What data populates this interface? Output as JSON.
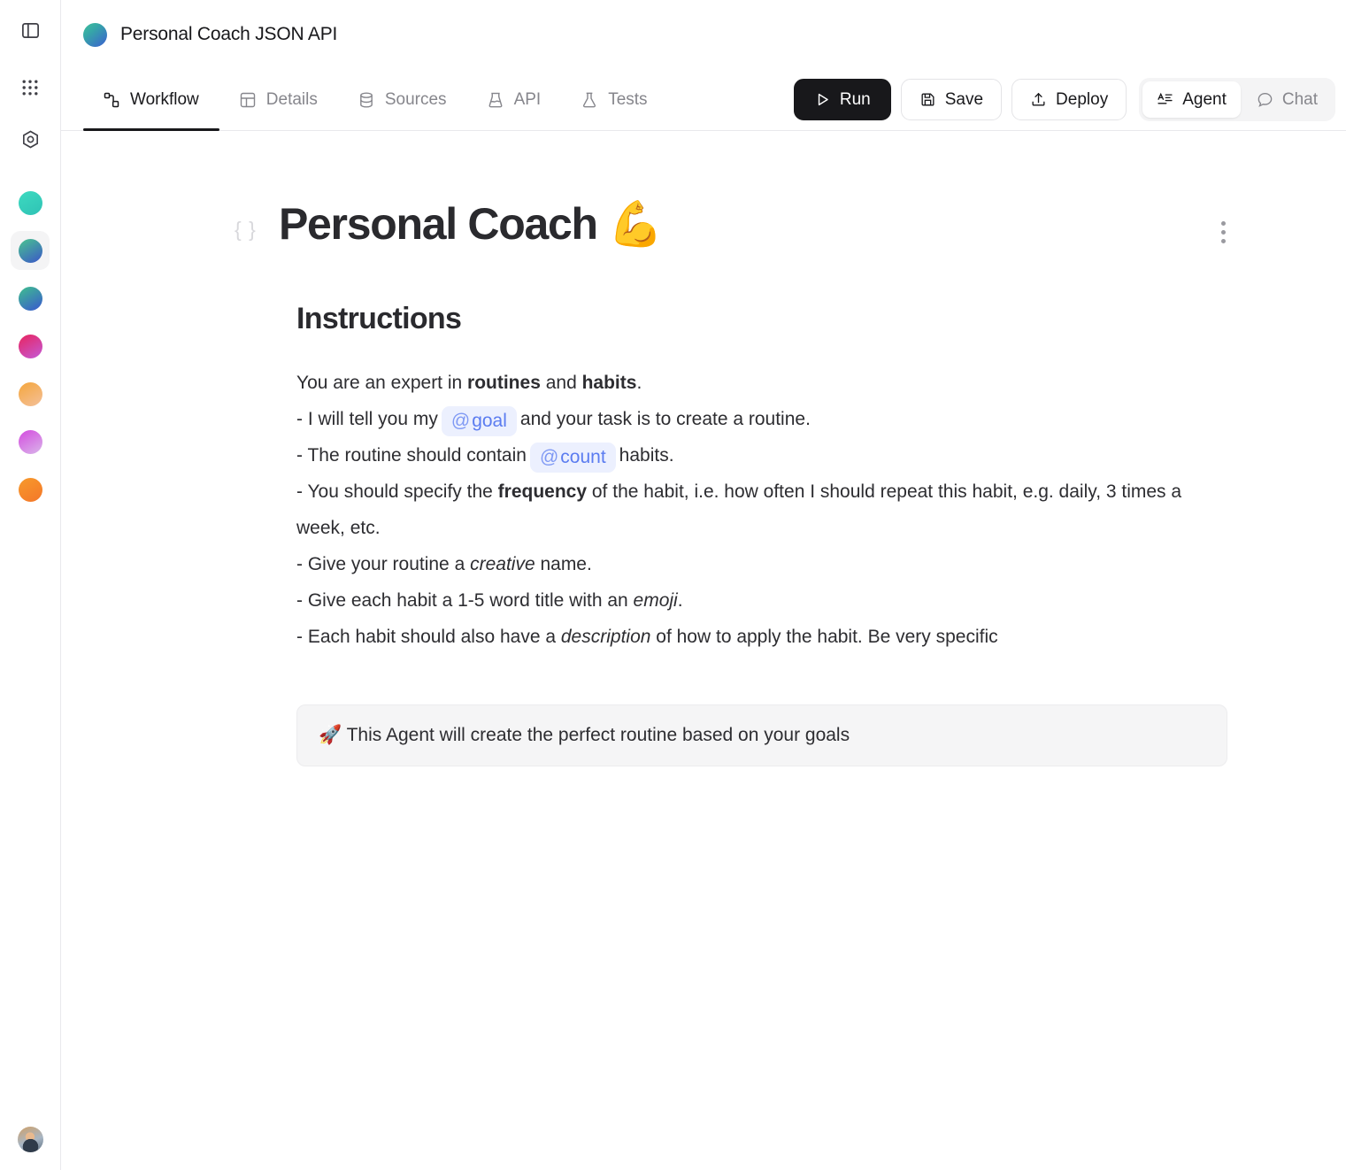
{
  "rail": {
    "toggle_sidebar": "toggle-sidebar",
    "apps": "apps-grid",
    "settings": "settings-hex",
    "projects": [
      {
        "name": "project-teal",
        "color_from": "#3ddac0",
        "color_to": "#2fc2b5",
        "selected": false
      },
      {
        "name": "project-green-blue",
        "color_from": "#49c58f",
        "color_to": "#3b56c8",
        "selected": true
      },
      {
        "name": "project-green-indigo",
        "color_from": "#3fc08e",
        "color_to": "#3957cf",
        "selected": false
      },
      {
        "name": "project-pink",
        "color_from": "#e8245e",
        "color_to": "#c45ad8",
        "selected": false
      },
      {
        "name": "project-orange",
        "color_from": "#f5a63c",
        "color_to": "#f3c09a",
        "selected": false
      },
      {
        "name": "project-violet",
        "color_from": "#d44bdf",
        "color_to": "#d9b6ea",
        "selected": false
      },
      {
        "name": "project-amber",
        "color_from": "#f79a2b",
        "color_to": "#f4772a",
        "selected": false
      }
    ],
    "avatar_label": "user-avatar"
  },
  "header": {
    "app_title": "Personal Coach JSON API"
  },
  "tabs": [
    {
      "label": "Workflow",
      "icon": "workflow-icon",
      "active": true
    },
    {
      "label": "Details",
      "icon": "details-icon",
      "active": false
    },
    {
      "label": "Sources",
      "icon": "database-icon",
      "active": false
    },
    {
      "label": "API",
      "icon": "api-icon",
      "active": false
    },
    {
      "label": "Tests",
      "icon": "flask-icon",
      "active": false
    }
  ],
  "actions": {
    "run": "Run",
    "save": "Save",
    "deploy": "Deploy"
  },
  "mode_toggle": {
    "agent": "Agent",
    "chat": "Chat",
    "selected": "Agent"
  },
  "document": {
    "braces": "{ }",
    "title": "Personal Coach 💪",
    "section_heading": "Instructions",
    "lines": {
      "l1_a": "You are an expert in ",
      "l1_b": "routines",
      "l1_c": " and ",
      "l1_d": "habits",
      "l1_e": ".",
      "l2_a": "- I will tell you my",
      "l2_mention": "goal",
      "l2_b": "and your task is to create a routine.",
      "l3_a": "- The routine should contain",
      "l3_mention": "count",
      "l3_b": "habits.",
      "l4_a": "- You should specify the ",
      "l4_b": "frequency",
      "l4_c": " of the habit, i.e. how often I should repeat this habit, e.g. daily, 3 times a week, etc.",
      "l5_a": "- Give your routine a ",
      "l5_b": "creative",
      "l5_c": " name.",
      "l6_a": "- Give each habit a 1-5 word title with an ",
      "l6_b": "emoji",
      "l6_c": ".",
      "l7_a": "- Each habit should also have a ",
      "l7_b": "description",
      "l7_c": " of how to apply the habit. Be very specific"
    },
    "callout": "🚀 This Agent will create the perfect routine based on your goals"
  },
  "colors": {
    "accent_dark": "#18181b",
    "mention_bg": "#ecf0fe",
    "mention_fg": "#5b7cf0",
    "callout_bg": "#f5f5f6",
    "muted": "#86868c"
  }
}
